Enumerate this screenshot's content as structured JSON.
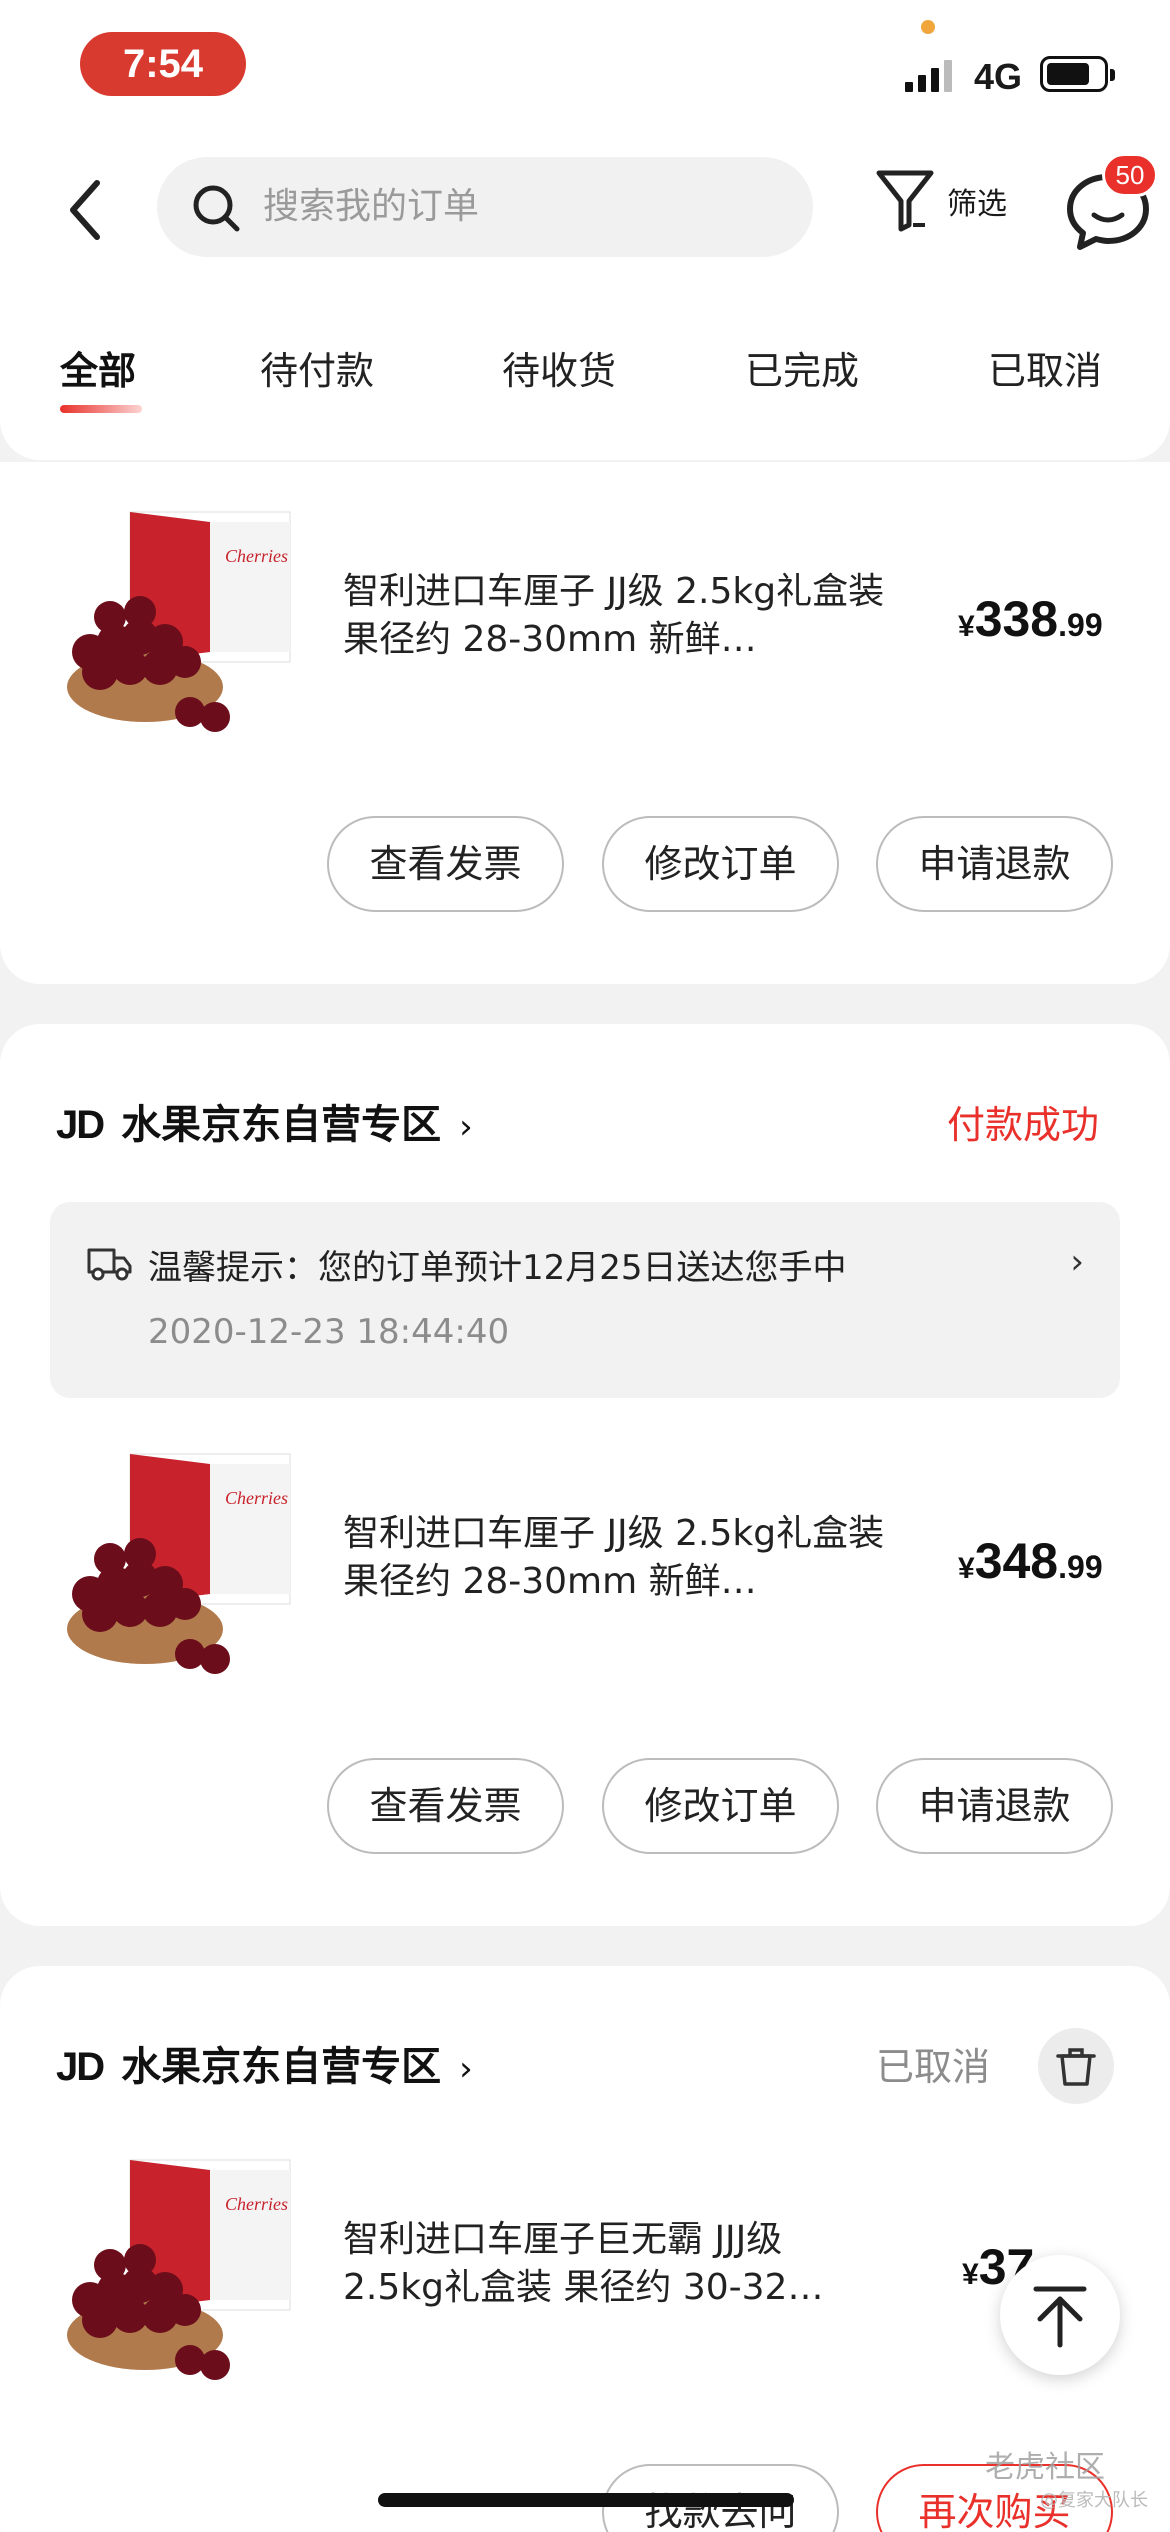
{
  "status_bar": {
    "time": "7:54",
    "network": "4G"
  },
  "header": {
    "search_placeholder": "搜索我的订单",
    "filter_label": "筛选",
    "message_badge": "50"
  },
  "tabs": [
    {
      "label": "全部",
      "active": true
    },
    {
      "label": "待付款",
      "active": false
    },
    {
      "label": "待收货",
      "active": false
    },
    {
      "label": "已完成",
      "active": false
    },
    {
      "label": "已取消",
      "active": false
    }
  ],
  "orders": [
    {
      "product_name": "智利进口车厘子 JJ级 2.5kg礼盒装 果径约 28-30mm 新鲜…",
      "price": {
        "currency": "¥",
        "integer": "338",
        "decimal": ".99"
      },
      "actions": [
        "查看发票",
        "修改订单",
        "申请退款"
      ]
    },
    {
      "shop_prefix": "JD",
      "shop_name": "水果京东自营专区",
      "chevron": "›",
      "status": "付款成功",
      "status_color": "#e9302a",
      "tip": "温馨提示：您的订单预计12月25日送达您手中",
      "tip_chevron": "›",
      "tip_date": "2020-12-23 18:44:40",
      "product_name": "智利进口车厘子 JJ级 2.5kg礼盒装 果径约 28-30mm 新鲜…",
      "price": {
        "currency": "¥",
        "integer": "348",
        "decimal": ".99"
      },
      "actions": [
        "查看发票",
        "修改订单",
        "申请退款"
      ]
    },
    {
      "shop_prefix": "JD",
      "shop_name": "水果京东自营专区",
      "chevron": "›",
      "status": "已取消",
      "status_color": "#8c8c8c",
      "product_name": "智利进口车厘子巨无霸 JJJ级 2.5kg礼盒装 果径约 30-32…",
      "price": {
        "currency": "¥",
        "integer": "37",
        "decimal": ""
      },
      "actions": [
        "找款去问",
        "再次购买"
      ]
    }
  ],
  "watermark": "老虎社区",
  "watermark_sub": "@复家大队长",
  "colors": {
    "accent": "#e9302a",
    "page_bg": "#f2f2f2"
  }
}
